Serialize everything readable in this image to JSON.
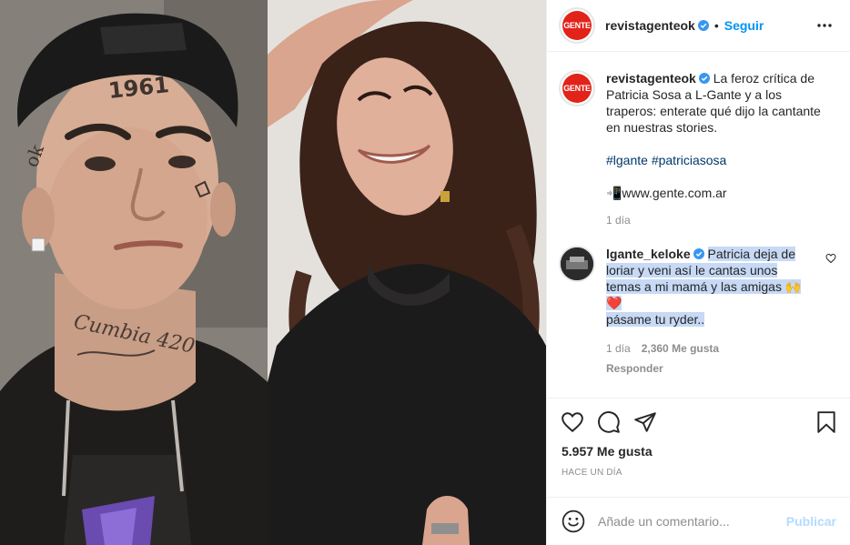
{
  "post": {
    "author": "revistagenteok",
    "follow_label": "Seguir",
    "separator": "•",
    "logo_text": "GENTE"
  },
  "caption": {
    "author": "revistagenteok",
    "text": "La feroz crítica de Patricia Sosa a L-Gante y a los traperos: enterate qué dijo la cantante en nuestras stories.",
    "hashtags": "#lgante #patriciasosa",
    "link": "📲www.gente.com.ar",
    "time": "1 día"
  },
  "reply": {
    "author": "lgante_keloke",
    "text_line1": "Patricia deja de loriar y veni así le cantas unos temas a mi mamá y las amigas 🙌",
    "text_line2": "❤️",
    "text_line3": "pásame tu ryder..",
    "time": "1 día",
    "likes": "2,360 Me gusta",
    "reply_label": "Responder"
  },
  "actions": {
    "likes": "5.957 Me gusta",
    "timestamp": "HACE UN DÍA"
  },
  "comment_box": {
    "placeholder": "Añade un comentario...",
    "publish_label": "Publicar"
  },
  "colors": {
    "accent": "#0095f6",
    "brand_red": "#e2231a",
    "hashtag": "#00376b",
    "highlight": "#c7d9f5",
    "publish_disabled": "#b3dbff"
  }
}
